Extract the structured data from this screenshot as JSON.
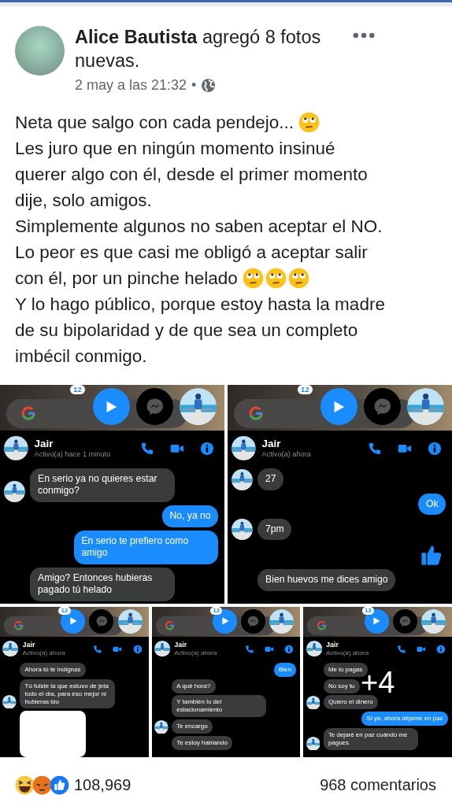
{
  "post": {
    "author": "Alice Bautista",
    "action": "agregó 8 fotos nuevas.",
    "time": "2 may a las 21:32",
    "separator": "•"
  },
  "text": [
    {
      "segments": [
        {
          "kind": "text",
          "text": "Neta que salgo con cada pendejo..."
        },
        {
          "kind": "emoji"
        }
      ]
    },
    {
      "segments": [
        {
          "kind": "text",
          "text": "Les juro que en ningún momento insinué"
        }
      ]
    },
    {
      "segments": [
        {
          "kind": "text",
          "text": "querer algo con él, desde el primer momento"
        }
      ]
    },
    {
      "segments": [
        {
          "kind": "text",
          "text": "dije, solo amigos."
        }
      ]
    },
    {
      "segments": [
        {
          "kind": "text",
          "text": "Simplemente algunos no saben aceptar el NO."
        }
      ]
    },
    {
      "segments": [
        {
          "kind": "text",
          "text": "Lo peor es que casi me obligó a aceptar salir"
        }
      ]
    },
    {
      "segments": [
        {
          "kind": "text",
          "text": "con él, por un pinche helado"
        },
        {
          "kind": "emoji"
        },
        {
          "kind": "emoji"
        },
        {
          "kind": "emoji"
        }
      ]
    },
    {
      "segments": [
        {
          "kind": "text",
          "text": "Y lo hago público, porque estoy hasta la madre"
        }
      ]
    },
    {
      "segments": [
        {
          "kind": "text",
          "text": "de su bipolaridad y de que sea un completo"
        }
      ]
    },
    {
      "segments": [
        {
          "kind": "text",
          "text": "imbécil conmigo."
        }
      ]
    }
  ],
  "photos": [
    {
      "kind": "large",
      "badge": "12",
      "contact": {
        "name": "Jair",
        "status": "Activo(a) hace 1 minuto"
      },
      "messages": [
        {
          "kind": "incoming",
          "avatar": true,
          "text": "En serio ya no quieres estar conmigo?"
        },
        {
          "kind": "outgoing",
          "text": "No, ya no"
        },
        {
          "kind": "outgoing",
          "text": "En serio te prefiero como amigo"
        },
        {
          "kind": "incoming",
          "avatar": false,
          "text": "Amigo? Entonces hubieras pagado tú helado"
        }
      ]
    },
    {
      "kind": "large",
      "badge": "12",
      "contact": {
        "name": "Jair",
        "status": "Activo(a) ahora"
      },
      "messages": [
        {
          "kind": "incoming",
          "avatar": true,
          "text": "27"
        },
        {
          "kind": "outgoing",
          "text": "Ok"
        },
        {
          "kind": "incoming",
          "avatar": true,
          "text": "7pm"
        },
        {
          "kind": "like"
        },
        {
          "kind": "incoming",
          "avatar": false,
          "text": "Bien huevos me dices amigo"
        }
      ]
    },
    {
      "kind": "small",
      "badge": "12",
      "contact": {
        "name": "Jair",
        "status": "Activo(a) ahora"
      },
      "messages": [
        {
          "kind": "incoming",
          "avatar": false,
          "text": "Ahora tú te indignas"
        },
        {
          "kind": "incoming",
          "avatar": true,
          "text": "Tú fuiste la que estuvo de jeta todo el día, para eso mejor ni hubieras ido"
        },
        {
          "kind": "image",
          "avatar": false
        }
      ]
    },
    {
      "kind": "small",
      "badge": "12",
      "contact": {
        "name": "Jair",
        "status": "Activo(a) ahora"
      },
      "messages": [
        {
          "kind": "outgoing",
          "text": "Bien"
        },
        {
          "kind": "incoming",
          "avatar": false,
          "text": "A qué hora?"
        },
        {
          "kind": "incoming",
          "avatar": false,
          "text": "Y también lo del estacionamiento"
        },
        {
          "kind": "incoming",
          "avatar": true,
          "text": "Te encargo"
        },
        {
          "kind": "incoming",
          "avatar": false,
          "text": "Te estoy hablando"
        }
      ]
    },
    {
      "kind": "small",
      "badge": "13",
      "overlay": "+4",
      "contact": {
        "name": "Jair",
        "status": "Activo(a) ahora"
      },
      "messages": [
        {
          "kind": "incoming",
          "avatar": false,
          "text": "Me lo pagas"
        },
        {
          "kind": "incoming",
          "avatar": false,
          "text": "No soy tu"
        },
        {
          "kind": "incoming",
          "avatar": true,
          "text": "Quiero el dinero"
        },
        {
          "kind": "outgoing",
          "text": "Si ya, ahora déjame en paz"
        },
        {
          "kind": "incoming",
          "avatar": true,
          "text": "Te dejaré en paz cuándo me pagues"
        }
      ]
    }
  ],
  "reactions": {
    "count": "108,969",
    "comments": "968 comentarios"
  }
}
